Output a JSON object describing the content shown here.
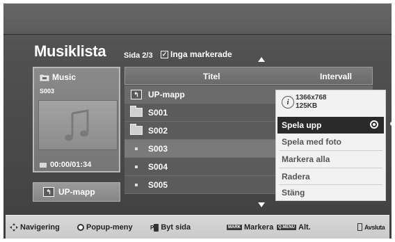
{
  "header": {
    "title": "Musiklista",
    "page_info": "Sida 2/3",
    "marked_label": "Inga markerade"
  },
  "card": {
    "folder": "Music",
    "track": "S003",
    "time": "00:00/01:34"
  },
  "up_button": {
    "label": "UP-mapp"
  },
  "columns": {
    "title": "Titel",
    "interval": "Intervall"
  },
  "rows": [
    {
      "type": "up",
      "label": "UP-mapp"
    },
    {
      "type": "folder",
      "label": "S001"
    },
    {
      "type": "folder",
      "label": "S002"
    },
    {
      "type": "file",
      "label": "S003",
      "selected": true
    },
    {
      "type": "file",
      "label": "S004"
    },
    {
      "type": "file",
      "label": "S005"
    }
  ],
  "popup": {
    "resolution": "1366x768",
    "size": "125KB",
    "items": [
      "Spela upp",
      "Spela med foto",
      "Markera alla",
      "Radera",
      "Stäng"
    ]
  },
  "footer": {
    "nav": "Navigering",
    "popup": "Popup-meny",
    "page_prefix": "P",
    "page": "Byt sida",
    "mark_tag": "MARK",
    "mark": "Markera",
    "menu_tag": "Q.MENU",
    "menu": "Alt.",
    "exit": "Avsluta"
  },
  "colors": {
    "background": "#505050",
    "popup_selected": "#2a2a2a",
    "footer": "#d0d0d0"
  }
}
